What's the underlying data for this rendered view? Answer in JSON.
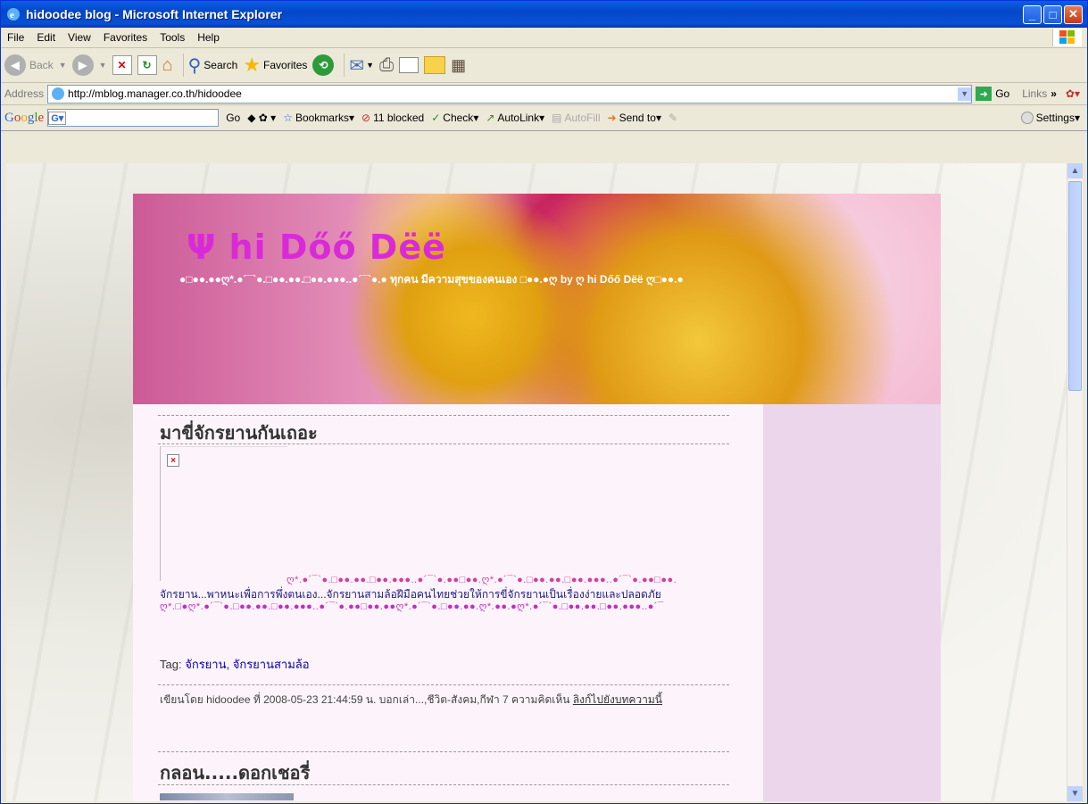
{
  "window": {
    "title": "hidoodee blog - Microsoft Internet Explorer"
  },
  "menu": [
    "File",
    "Edit",
    "View",
    "Favorites",
    "Tools",
    "Help"
  ],
  "toolbar": {
    "back": "Back",
    "search": "Search",
    "favorites": "Favorites"
  },
  "address": {
    "label": "Address",
    "url": "http://mblog.manager.co.th/hidoodee",
    "go": "Go",
    "links": "Links"
  },
  "google": {
    "label": "Google",
    "go": "Go",
    "bookmarks": "Bookmarks",
    "blocked": "11 blocked",
    "check": "Check",
    "autolink": "AutoLink",
    "autofill": "AutoFill",
    "sendto": "Send to",
    "settings": "Settings"
  },
  "blog": {
    "title": "Ψ hi Dőő Dëë",
    "subtitle": "●□●●.●●ღ*.●´¯`●.□●●.●●.□●●.●●●..●´¯`●.● ทุกคน มีความสุขของคนเอง □●●.●ღ by ღ hi Dőő Dëë ღ□●●.●"
  },
  "post1": {
    "title": "มาขี่จักรยานกันเถอะ",
    "deco_line1": "ღ*.●´¯`●.□●●.●●.□●●.●●●..●´¯`●.●●□●●.ღ*.●´¯`●.□●●.●●.□●●.●●●..●´¯`●.●●□●●.",
    "body": "จักรยาน...พาหนะเพื่อการพึ่งตนเอง...จักรยานสามล้อฝีมือคนไทยช่วยให้การขี่จักรยานเป็นเรื่องง่ายและปลอดภัย",
    "deco_line2": "ღ*.□●ღ*.●´¯`●.□●●.●●.□●●.●●●..●´¯`●.●●□●●.●●ღ*.●´¯`●.□●●.●●.ღ*.●●.●ღ*.●´¯`●.□●●.●●.□●●.●●●..●´¯",
    "tag_label": "Tag:",
    "tags": "จักรยาน, จักรยานสามล้อ",
    "meta": "เขียนโดย hidoodee ที่ 2008-05-23 21:44:59 น. บอกเล่า...,ชีวิต-สังคม,กีฬา 7 ความคิดเห็น ",
    "link": "ลิงก์ไปยังบทความนี้"
  },
  "post2": {
    "title": "กลอน.....ดอกเชอรี่"
  },
  "colors": {
    "title_magenta": "#d92ad7",
    "xp_blue": "#0a4fd6",
    "content_bg": "#fdf4fb",
    "sidebar_bg": "#ecd6ec"
  }
}
